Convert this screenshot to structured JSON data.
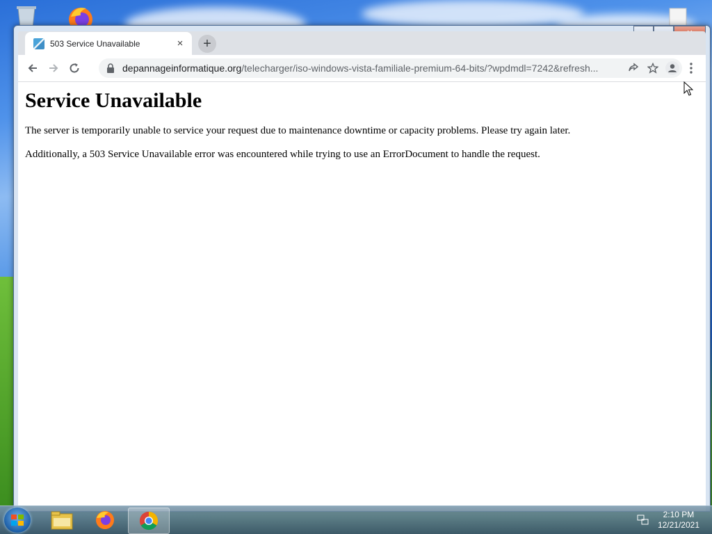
{
  "browser": {
    "tab": {
      "title": "503 Service Unavailable",
      "close_glyph": "×"
    },
    "new_tab_glyph": "+",
    "window_controls": {
      "minimize": "—",
      "maximize": "▫",
      "close": "✕"
    },
    "address": {
      "domain": "depannageinformatique.org",
      "path": "/telecharger/iso-windows-vista-familiale-premium-64-bits/?wpdmdl=7242&refresh..."
    },
    "icons": [
      "back-icon",
      "forward-icon",
      "reload-icon",
      "lock-icon",
      "share-icon",
      "star-icon",
      "profile-icon",
      "menu-icon"
    ]
  },
  "page": {
    "heading": "Service Unavailable",
    "paragraphs": [
      "The server is temporarily unable to service your request due to maintenance downtime or capacity problems. Please try again later.",
      "Additionally, a 503 Service Unavailable error was encountered while trying to use an ErrorDocument to handle the request."
    ]
  },
  "taskbar": {
    "items": [
      "start-button",
      "file-explorer",
      "firefox",
      "chrome"
    ],
    "active_item": "chrome",
    "clock": {
      "time": "2:10 PM",
      "date": "12/21/2021"
    }
  }
}
